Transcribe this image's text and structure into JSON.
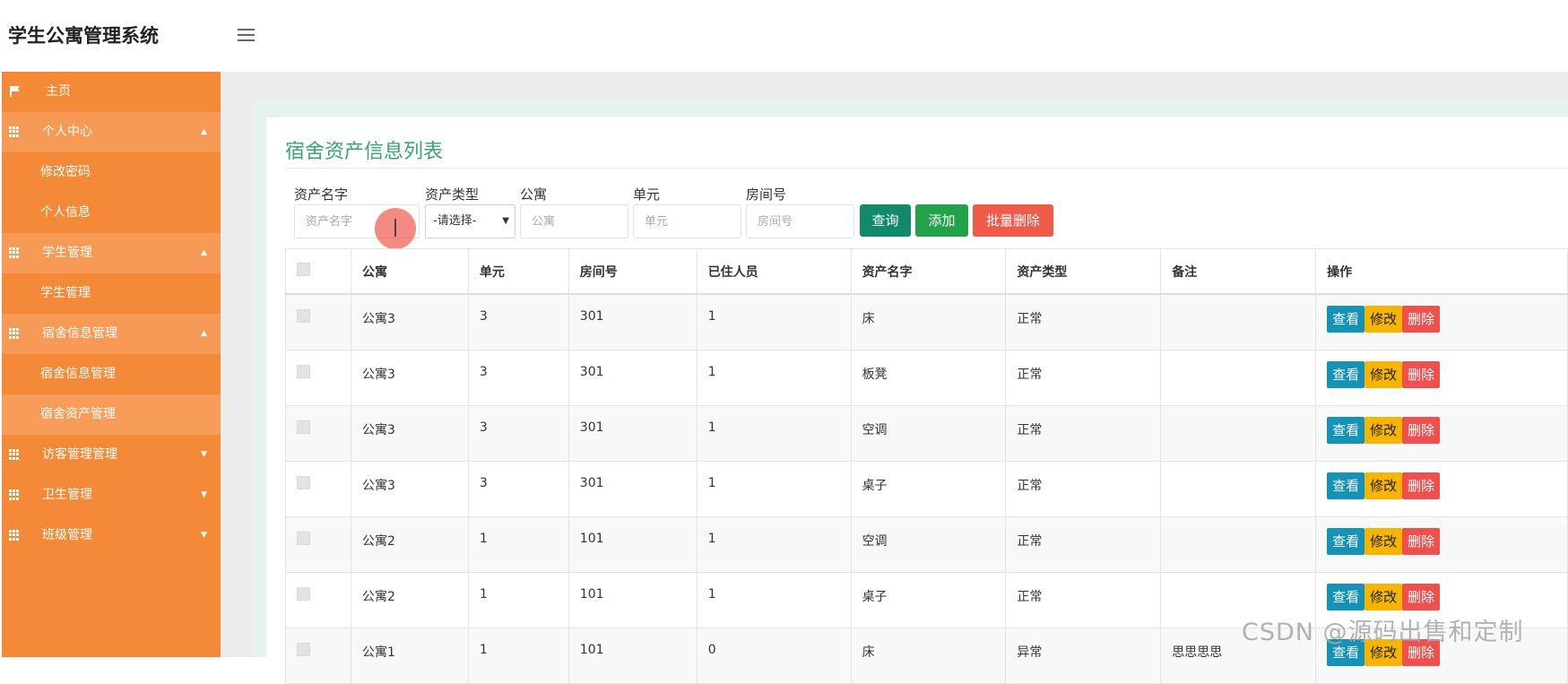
{
  "app": {
    "title": "学生公寓管理系统"
  },
  "sidebar": {
    "items": [
      {
        "label": "主页",
        "type": "home",
        "icon": "flag-icon"
      },
      {
        "label": "个人中心",
        "type": "group",
        "icon": "grid-icon",
        "caret": "▲"
      },
      {
        "label": "修改密码",
        "type": "sub"
      },
      {
        "label": "个人信息",
        "type": "sub"
      },
      {
        "label": "学生管理",
        "type": "group",
        "icon": "grid-icon",
        "caret": "▲"
      },
      {
        "label": "学生管理",
        "type": "sub"
      },
      {
        "label": "宿舍信息管理",
        "type": "group",
        "icon": "grid-icon",
        "caret": "▲"
      },
      {
        "label": "宿舍信息管理",
        "type": "sub"
      },
      {
        "label": "宿舍资产管理",
        "type": "sub",
        "active": true
      },
      {
        "label": "访客管理管理",
        "type": "group",
        "icon": "grid-icon",
        "caret": "▼"
      },
      {
        "label": "卫生管理",
        "type": "group",
        "icon": "grid-icon",
        "caret": "▼"
      },
      {
        "label": "班级管理",
        "type": "group",
        "icon": "grid-icon",
        "caret": "▼"
      }
    ]
  },
  "panel": {
    "title": "宿舍资产信息列表"
  },
  "filters": {
    "asset_name": {
      "label": "资产名字",
      "placeholder": "资产名字"
    },
    "asset_type": {
      "label": "资产类型",
      "value": "-请选择-"
    },
    "apartment": {
      "label": "公寓",
      "placeholder": "公寓"
    },
    "unit": {
      "label": "单元",
      "placeholder": "单元"
    },
    "room": {
      "label": "房间号",
      "placeholder": "房间号"
    },
    "query_label": "查询",
    "add_label": "添加",
    "batch_delete_label": "批量删除"
  },
  "table": {
    "headers": [
      "",
      "公寓",
      "单元",
      "房间号",
      "已住人员",
      "资产名字",
      "资产类型",
      "备注",
      "操作"
    ],
    "actions": {
      "view": "查看",
      "edit": "修改",
      "delete": "删除"
    },
    "rows": [
      [
        "公寓3",
        "3",
        "301",
        "1",
        "床",
        "正常",
        ""
      ],
      [
        "公寓3",
        "3",
        "301",
        "1",
        "板凳",
        "正常",
        ""
      ],
      [
        "公寓3",
        "3",
        "301",
        "1",
        "空调",
        "正常",
        ""
      ],
      [
        "公寓3",
        "3",
        "301",
        "1",
        "桌子",
        "正常",
        ""
      ],
      [
        "公寓2",
        "1",
        "101",
        "1",
        "空调",
        "正常",
        ""
      ],
      [
        "公寓2",
        "1",
        "101",
        "1",
        "桌子",
        "正常",
        ""
      ],
      [
        "公寓1",
        "1",
        "101",
        "0",
        "床",
        "异常",
        "思思思思"
      ]
    ]
  },
  "watermark": "CSDN @源码出售和定制",
  "colors": {
    "sidebar": "#f48a38",
    "accent_title": "#3aa36f"
  }
}
